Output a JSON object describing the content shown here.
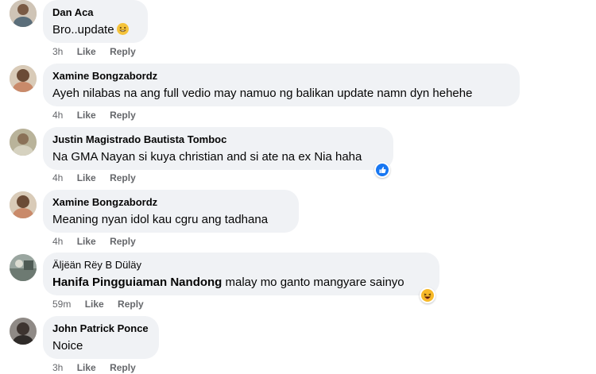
{
  "comments": [
    {
      "author": "Dan Aca",
      "text": "Bro..update",
      "emoji": "grinning-emoji",
      "time": "3h",
      "like_label": "Like",
      "reply_label": "Reply"
    },
    {
      "author": "Xamine Bongzabordz",
      "text": "Ayeh nilabas na ang full vedio may namuo ng balikan update namn dyn hehehe",
      "time": "4h",
      "like_label": "Like",
      "reply_label": "Reply"
    },
    {
      "author": "Justin Magistrado Bautista Tomboc",
      "text": "Na GMA Nayan si kuya christian and si ate na ex Nia haha",
      "reaction": "like-reaction-icon",
      "time": "4h",
      "like_label": "Like",
      "reply_label": "Reply"
    },
    {
      "author": "Xamine Bongzabordz",
      "text": "Meaning nyan idol kau cgru ang tadhana",
      "time": "4h",
      "like_label": "Like",
      "reply_label": "Reply"
    },
    {
      "author": "Äljëän Rëy B Düläy",
      "mention": "Hanifa Pingguiaman Nandong",
      "text": " malay mo ganto mangyare sainyo",
      "reaction": "haha-reaction-icon",
      "time": "59m",
      "like_label": "Like",
      "reply_label": "Reply"
    },
    {
      "author": "John Patrick Ponce",
      "text": "Noice",
      "time": "3h",
      "like_label": "Like",
      "reply_label": "Reply"
    }
  ],
  "colors": {
    "bubble": "#f0f2f5",
    "secondary_text": "#65676b",
    "like_blue": "#1877f2",
    "haha_yellow": "#f7b928"
  }
}
